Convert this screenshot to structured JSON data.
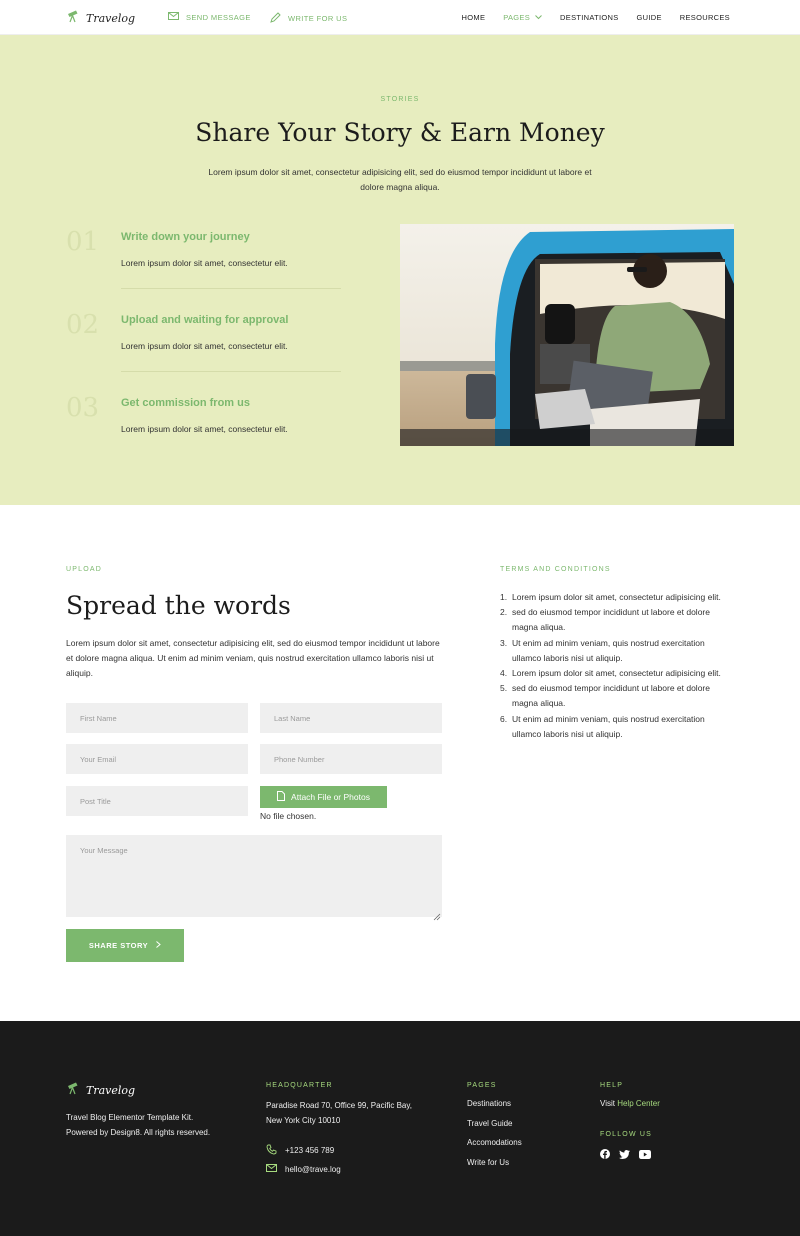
{
  "header": {
    "logo_text": "Travelog",
    "send_message": "SEND MESSAGE",
    "write_for_us": "WRITE FOR US",
    "nav": {
      "home": "HOME",
      "pages": "PAGES",
      "destinations": "DESTINATIONS",
      "guide": "GUIDE",
      "resources": "RESOURCES"
    }
  },
  "hero": {
    "eyebrow": "STORIES",
    "title": "Share Your Story & Earn Money",
    "description": "Lorem ipsum dolor sit amet, consectetur adipisicing elit, sed do eiusmod tempor incididunt ut labore et dolore magna aliqua.",
    "steps": [
      {
        "number": "01",
        "title": "Write down your journey",
        "text": "Lorem ipsum dolor sit amet, consectetur elit."
      },
      {
        "number": "02",
        "title": "Upload and waiting for approval",
        "text": "Lorem ipsum dolor sit amet, consectetur elit."
      },
      {
        "number": "03",
        "title": "Get commission from us",
        "text": "Lorem ipsum dolor sit amet, consectetur elit."
      }
    ]
  },
  "upload": {
    "eyebrow": "UPLOAD",
    "title": "Spread the words",
    "description": "Lorem ipsum dolor sit amet, consectetur adipisicing elit, sed do eiusmod tempor incididunt ut labore et dolore magna aliqua. Ut enim ad minim veniam, quis nostrud exercitation ullamco laboris nisi ut aliquip.",
    "form": {
      "first_name_placeholder": "First Name",
      "last_name_placeholder": "Last Name",
      "email_placeholder": "Your Email",
      "phone_placeholder": "Phone Number",
      "post_title_placeholder": "Post Title",
      "attach_label": "Attach File or Photos",
      "no_file": "No file chosen.",
      "message_placeholder": "Your Message",
      "submit_label": "SHARE STORY"
    }
  },
  "terms": {
    "eyebrow": "TERMS AND CONDITIONS",
    "items": [
      {
        "n": "1.",
        "text": "Lorem ipsum dolor sit amet, consectetur adipisicing elit."
      },
      {
        "n": "2.",
        "text": "sed do eiusmod tempor incididunt ut labore et dolore magna aliqua."
      },
      {
        "n": "3.",
        "text": "Ut enim ad minim veniam, quis nostrud exercitation ullamco laboris nisi ut aliquip."
      },
      {
        "n": "4.",
        "text": "Lorem ipsum dolor sit amet, consectetur adipisicing elit."
      },
      {
        "n": "5.",
        "text": "sed do eiusmod tempor incididunt ut labore et dolore magna aliqua."
      },
      {
        "n": "6.",
        "text": "Ut enim ad minim veniam, quis nostrud exercitation ullamco laboris nisi ut aliquip."
      }
    ]
  },
  "footer": {
    "logo_text": "Travelog",
    "about": "Travel Blog Elementor Template Kit. Powered by Design8. All rights reserved.",
    "headquarter": {
      "eyebrow": "HEADQUARTER",
      "address": "Paradise Road 70, Office 99, Pacific Bay,  New York City 10010",
      "phone": "+123 456 789",
      "email": "hello@trave.log"
    },
    "pages": {
      "eyebrow": "PAGES",
      "links": [
        "Destinations",
        "Travel Guide",
        "Accomodations",
        "Write for Us"
      ]
    },
    "help": {
      "eyebrow": "HELP",
      "visit": "Visit",
      "help_center": "Help Center",
      "follow_eyebrow": "FOLLOW US"
    }
  },
  "icons": {
    "logo": "telescope-icon",
    "send": "envelope-icon",
    "write": "pencil-icon",
    "dropdown": "chevron-down-icon",
    "attach": "file-icon",
    "submit": "chevron-right-icon",
    "phone": "phone-icon",
    "email": "envelope-icon",
    "social": [
      "facebook-icon",
      "twitter-icon",
      "youtube-icon"
    ]
  },
  "colors": {
    "accent": "#7cb86e",
    "hero_bg": "#e7edbf",
    "footer_bg": "#1b1b1b",
    "footer_accent": "#a7db7f",
    "field_bg": "#efefef"
  }
}
